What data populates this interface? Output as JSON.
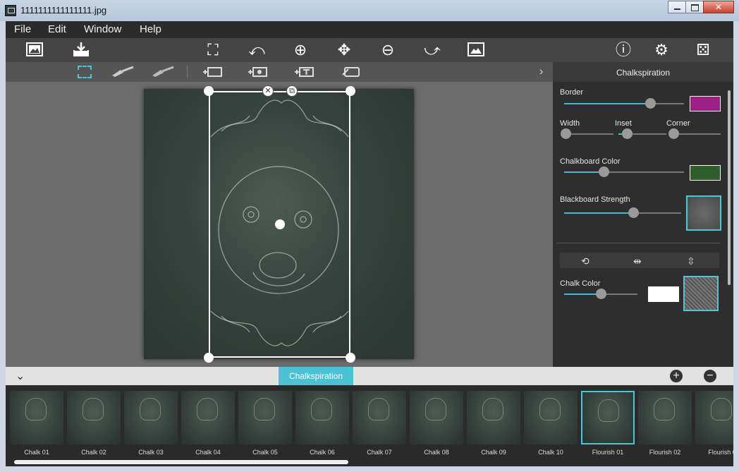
{
  "window": {
    "title": "1111111111111111.jpg",
    "close_glyph": "✕"
  },
  "menu": {
    "items": [
      "File",
      "Edit",
      "Window",
      "Help"
    ]
  },
  "toolbar_icons": {
    "crop": "⛶",
    "rotate_left": "⤺",
    "zoom_in": "⊕",
    "move": "✥",
    "zoom_out": "⊖",
    "redo": "⤻",
    "info": "ⓘ",
    "settings": "⚙",
    "random": "⚄"
  },
  "panel": {
    "title": "Chalkspiration",
    "border_label": "Border",
    "width_label": "Width",
    "inset_label": "Inset",
    "corner_label": "Corner",
    "chalkboard_color_label": "Chalkboard Color",
    "blackboard_strength_label": "Blackboard Strength",
    "chalk_color_label": "Chalk Color",
    "colors": {
      "border": "#9c1f86",
      "chalkboard": "#2f5e2c",
      "chalk": "#ffffff",
      "accent": "#4fb6cf"
    },
    "sliders": {
      "border": 0.72,
      "width": 0.0,
      "inset": 0.18,
      "corner": 0.0,
      "chalkboard_color": 0.33,
      "blackboard_strength": 0.59,
      "chalk_color": 0.5
    }
  },
  "strip": {
    "tab_label": "Chalkspiration",
    "add_glyph": "+",
    "remove_glyph": "−",
    "collapse_glyph": "⌄",
    "presets": [
      "Chalk 01",
      "Chalk 02",
      "Chalk 03",
      "Chalk 04",
      "Chalk 05",
      "Chalk 06",
      "Chalk 07",
      "Chalk 08",
      "Chalk 09",
      "Chalk 10",
      "Flourish 01",
      "Flourish 02",
      "Flourish 0"
    ],
    "selected_index": 10
  }
}
